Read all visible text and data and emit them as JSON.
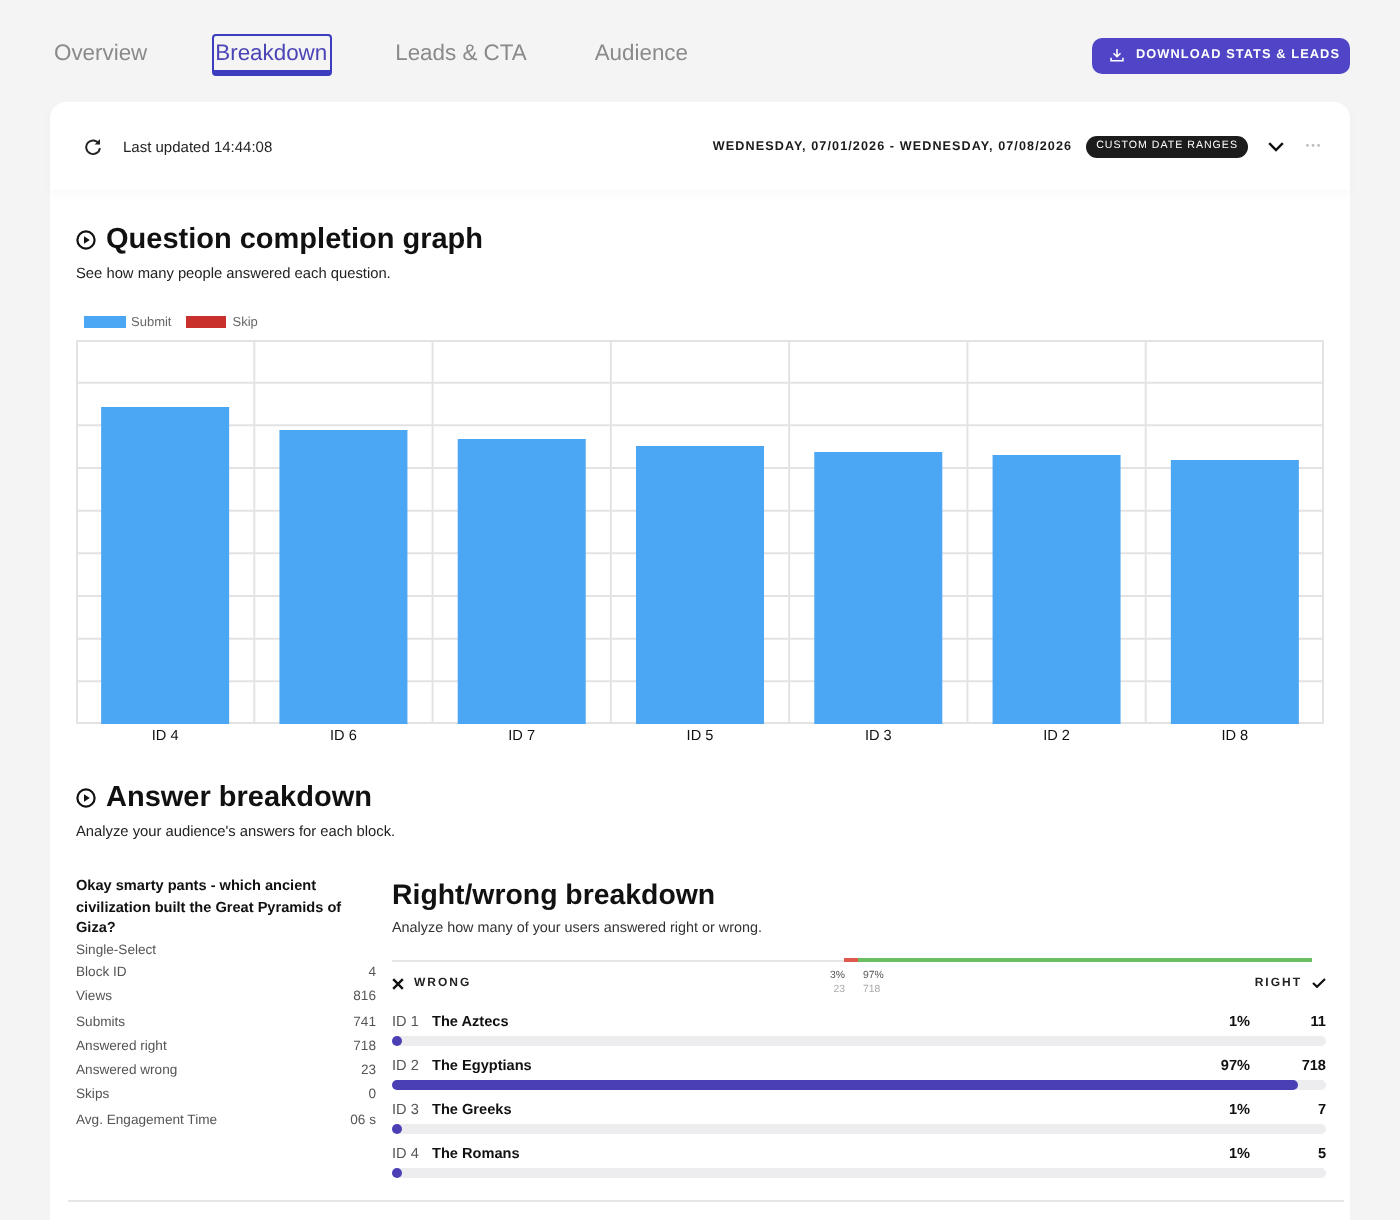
{
  "tabs": [
    {
      "label": "Overview",
      "selected": false
    },
    {
      "label": "Breakdown",
      "selected": true
    },
    {
      "label": "Leads & CTA",
      "selected": false
    },
    {
      "label": "Audience",
      "selected": false
    }
  ],
  "download_button": {
    "label": "DOWNLOAD STATS & LEADS"
  },
  "report_header": {
    "last_updated": "Last updated 14:44:08",
    "date_range": "WEDNESDAY, 07/01/2026 - WEDNESDAY, 07/08/2026",
    "range_badge": "CUSTOM DATE RANGES"
  },
  "completion_graph": {
    "title": "Question completion graph",
    "subtitle": "See how many people answered each question.",
    "legend": [
      {
        "label": "Submit",
        "color": "#4ba6f4"
      },
      {
        "label": "Skip",
        "color": "#c8312b"
      }
    ],
    "categories": [
      "ID 4",
      "ID 6",
      "ID 7",
      "ID 5",
      "ID 3",
      "ID 2",
      "ID 8"
    ]
  },
  "answer_breakdown": {
    "title": "Answer breakdown",
    "subtitle": "Analyze your audience's answers for each block.",
    "question": {
      "text": "Okay smarty pants - which ancient civilization built the Great Pyramids of Giza?",
      "type": "Single-Select",
      "stats": [
        {
          "label": "Block ID",
          "value": "4"
        },
        {
          "label": "Views",
          "value": "816"
        },
        {
          "label": "Submits",
          "value": "741"
        },
        {
          "label": "Answered right",
          "value": "718"
        },
        {
          "label": "Answered wrong",
          "value": "23"
        },
        {
          "label": "Skips",
          "value": "0"
        },
        {
          "label": "Avg. Engagement Time",
          "value": "06 s"
        }
      ]
    },
    "right_wrong": {
      "title": "Right/wrong breakdown",
      "subtitle": "Analyze how many of your users answered right or wrong.",
      "summary": {
        "level": 0.97,
        "wrong_percent": "3%",
        "wrong_count": "23",
        "right_percent": "97%",
        "right_count": "718"
      },
      "wrong_label": "WRONG",
      "right_label": "RIGHT",
      "answers": [
        {
          "id": "ID 1",
          "label": "The Aztecs",
          "percent": "1%",
          "count": "11",
          "level": 0.01
        },
        {
          "id": "ID 2",
          "label": "The Egyptians",
          "percent": "97%",
          "count": "718",
          "level": 0.97
        },
        {
          "id": "ID 3",
          "label": "The Greeks",
          "percent": "1%",
          "count": "7",
          "level": 0.01
        },
        {
          "id": "ID 4",
          "label": "The Romans",
          "percent": "1%",
          "count": "5",
          "level": 0.01
        }
      ]
    }
  }
}
